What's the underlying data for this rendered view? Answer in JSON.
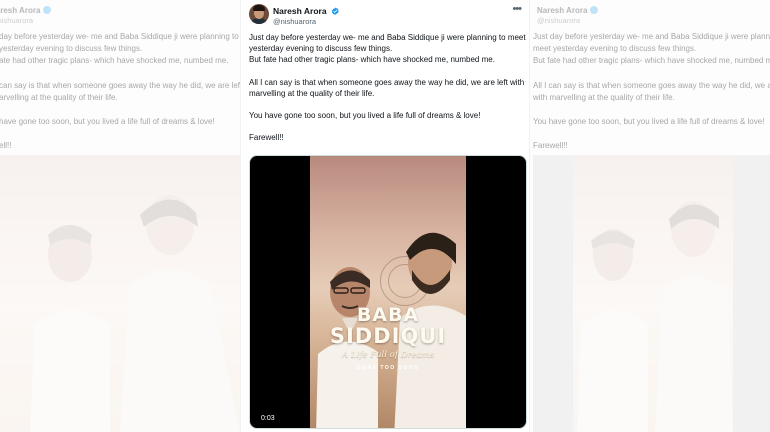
{
  "tweet": {
    "author_name": "Naresh Arora",
    "author_handle": "@nishuarora",
    "paragraphs": [
      "Just day before yesterday we- me and Baba Siddique ji were planning to meet yesterday evening to discuss few things.\nBut fate had other tragic plans- which have shocked me, numbed me.",
      "All I can say is that when someone goes away the way he did, we are left with marvelling at the quality of their life.",
      "You have gone too soon, but you lived a life full of dreams & love!",
      "Farewell!!"
    ],
    "more_icon": "more-horizontal-icon",
    "verified_icon": "verified-badge-icon",
    "verified_color": "#1d9bf0"
  },
  "video": {
    "poster_title_line1": "BABA",
    "poster_title_line2": "SIDDIQUI",
    "poster_subtitle": "A Life Full of Dreams",
    "poster_tagline": "GONE TOO SOON",
    "timestamp": "0:03"
  },
  "ghost_left": {
    "name": "Naresh Arora",
    "handle": "@nishuarora",
    "lines": [
      "day before yesterday we- me and Baba Siddique ji were planning to",
      "yesterday evening to discuss few things.",
      "ate had other tragic plans- which have shocked me, numbed me.",
      "can say is that when someone goes away the way he did, we are left",
      "arvelling at the quality of their life.",
      "have gone too soon, but you lived a life full of dreams & love!",
      "ell!!"
    ]
  },
  "ghost_right": {
    "name": "Naresh Arora",
    "handle": "@nishuarora",
    "lines": [
      "Just day before yesterday we- me and Baba Siddique ji were planni",
      "meet yesterday evening to discuss few things.",
      "But fate had other tragic plans- which have shocked me, numbed me.",
      "All I can say is that when someone goes away the way he did, we a",
      "with marvelling at the quality of their life.",
      "You have gone too soon, but you lived a life full of dreams & love!",
      "Farewell!!"
    ]
  }
}
